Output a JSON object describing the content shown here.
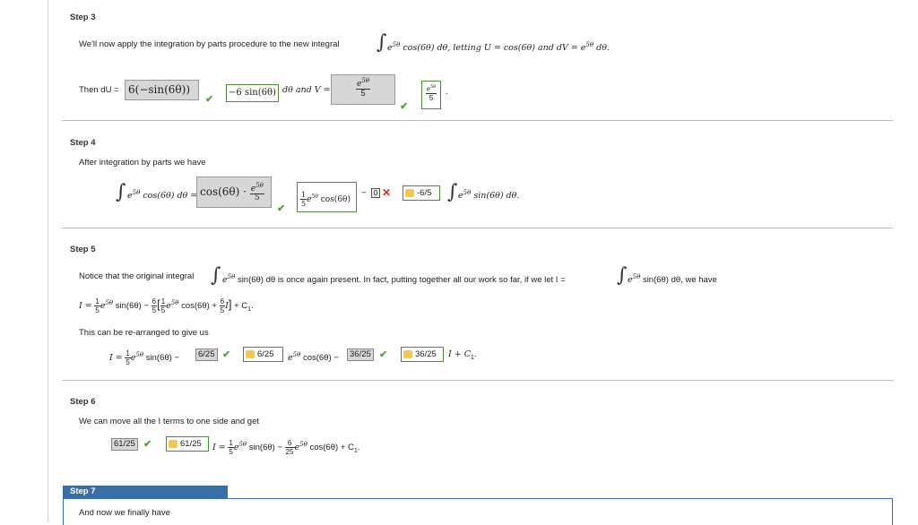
{
  "steps": {
    "s3": {
      "label": "Step 3",
      "intro": "We'll now apply the integration by parts procedure to the new integral",
      "integrand": "e",
      "integrand_exp": "5θ",
      "integrand_rest": "cos(6θ) dθ, letting U = cos(6θ) and dV = e",
      "dv_exp": "5θ",
      "dv_rest": "dθ.",
      "then_du": "Then dU =",
      "du_answer": "6(−sin(6θ))",
      "du_correct": "−6 sin(6θ)",
      "and_v": "dθ and V =",
      "v_answer_num": "e",
      "v_answer_num_exp": "5θ",
      "v_answer_den": "5",
      "v_correct_num": "e",
      "v_correct_num_exp": "5θ",
      "v_correct_den": "5",
      "period": "."
    },
    "s4": {
      "label": "Step 4",
      "intro": "After integration by parts we have",
      "lhs_e": "e",
      "lhs_exp": "5θ",
      "lhs_rest": "cos(6θ) dθ =",
      "ans1": "cos(6θ) ·",
      "ans1_frac_num": "e",
      "ans1_frac_num_exp": "5θ",
      "ans1_frac_den": "5",
      "corr1_num": "1",
      "corr1_den": "5",
      "corr1_rest": "e",
      "corr1_exp": "5θ",
      "corr1_tail": "cos(6θ)",
      "minus": "−",
      "ans2": "0",
      "corr2": "-6/5",
      "tail_e": "e",
      "tail_exp": "5θ",
      "tail_rest": "sin(6θ) dθ."
    },
    "s5": {
      "label": "Step 5",
      "intro": "Notice that the original integral",
      "intro_e": "e",
      "intro_exp": "5θ",
      "intro_rest": "sin(6θ) dθ is once again present. In fact, putting together all our work so far, if we let I =",
      "intro_e2": "e",
      "intro_exp2": "5θ",
      "intro_rest2": "sin(6θ) dθ, we have",
      "eq_I": "I =",
      "eq_f1_num": "1",
      "eq_f1_den": "5",
      "eq_e": "e",
      "eq_exp": "5θ",
      "eq_sin": "sin(6θ) −",
      "eq_f2_num": "6",
      "eq_f2_den": "5",
      "eq_f3_num": "1",
      "eq_f3_den": "5",
      "eq_e2": "e",
      "eq_exp2": "5θ",
      "eq_cos": "cos(6θ) +",
      "eq_f4_num": "6",
      "eq_f4_den": "5",
      "eq_I2": "I",
      "eq_tail": "+ C",
      "eq_sub": "1",
      "eq_dot": ".",
      "rearr": "This can be re-arranged to give us",
      "r_I": "I =",
      "r_f_num": "1",
      "r_f_den": "5",
      "r_e": "e",
      "r_exp": "5θ",
      "r_sin": "sin(6θ) −",
      "r_ans1": "6/25",
      "r_corr1": "6/25",
      "r_e2": "e",
      "r_exp2": "5θ",
      "r_cos": "cos(6θ) −",
      "r_ans2": "36/25",
      "r_corr2": "36/25",
      "r_tail": "I + C",
      "r_sub": "1",
      "r_dot": "."
    },
    "s6": {
      "label": "Step 6",
      "intro": "We can move all the I terms to one side and get",
      "ans": "61/25",
      "corr": "61/25",
      "eq_I": "I =",
      "f1_num": "1",
      "f1_den": "5",
      "e1": "e",
      "exp1": "5θ",
      "sin": "sin(6θ) −",
      "f2_num": "6",
      "f2_den": "25",
      "e2": "e",
      "exp2": "5θ",
      "cos": "cos(6θ) + C",
      "sub": "1",
      "dot": "."
    },
    "s7": {
      "label": "Step 7",
      "intro": "And now we finally have"
    }
  },
  "colors": {
    "check_green": "#5aa13a",
    "cross_red": "#d03030",
    "step_tab_blue": "#3a6ea8",
    "gray_box": "#d7d7d7"
  }
}
